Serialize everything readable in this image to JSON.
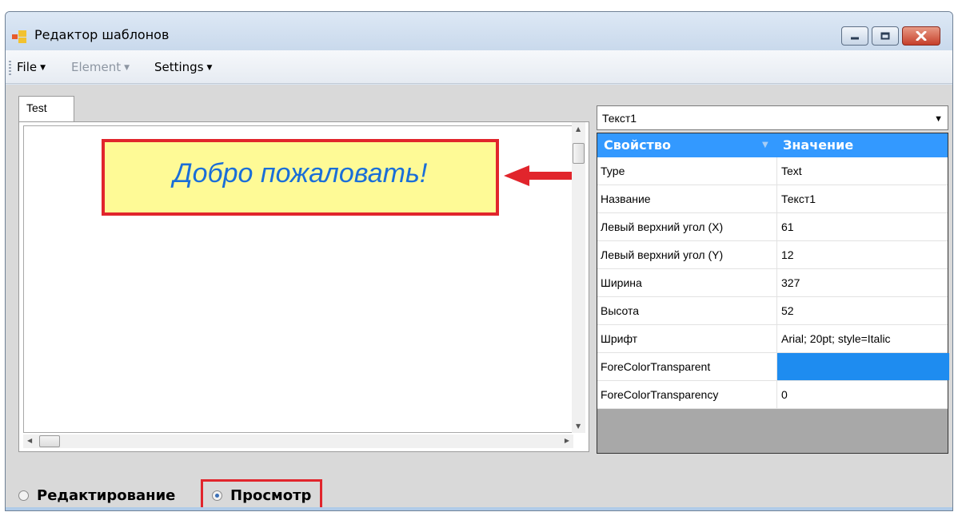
{
  "window": {
    "title": "Редактор шаблонов",
    "icon": "app-form-icon",
    "controls": [
      "minimize-icon",
      "maximize-icon",
      "close-icon"
    ]
  },
  "menu": {
    "file": "File",
    "element": "Element",
    "settings": "Settings",
    "element_disabled": true
  },
  "tabs": [
    {
      "label": "Test",
      "selected": true
    }
  ],
  "canvas": {
    "text_element": "Добро пожаловать!",
    "text_color": "#1a6ed8",
    "background": "#fefa96",
    "highlight_color": "#e1252c"
  },
  "element_selector": {
    "value": "Текст1"
  },
  "properties": {
    "header": {
      "property": "Свойство",
      "value": "Значение",
      "color": "#3399ff"
    },
    "rows": [
      {
        "name": "Type",
        "value": "Text"
      },
      {
        "name": "Название",
        "value": "Текст1"
      },
      {
        "name": "Левый верхний угол (X)",
        "value": "61"
      },
      {
        "name": "Левый верхний угол (Y)",
        "value": "12"
      },
      {
        "name": "Ширина",
        "value": "327"
      },
      {
        "name": "Высота",
        "value": "52"
      },
      {
        "name": "Шрифт",
        "value": "Arial; 20pt; style=Italic"
      },
      {
        "name": "ForeColorTransparent",
        "value": "",
        "swatch": "#1e8cf0"
      },
      {
        "name": "ForeColorTransparency",
        "value": "0"
      }
    ]
  },
  "mode": {
    "edit_label": "Редактирование",
    "view_label": "Просмотр",
    "selected": "view"
  }
}
